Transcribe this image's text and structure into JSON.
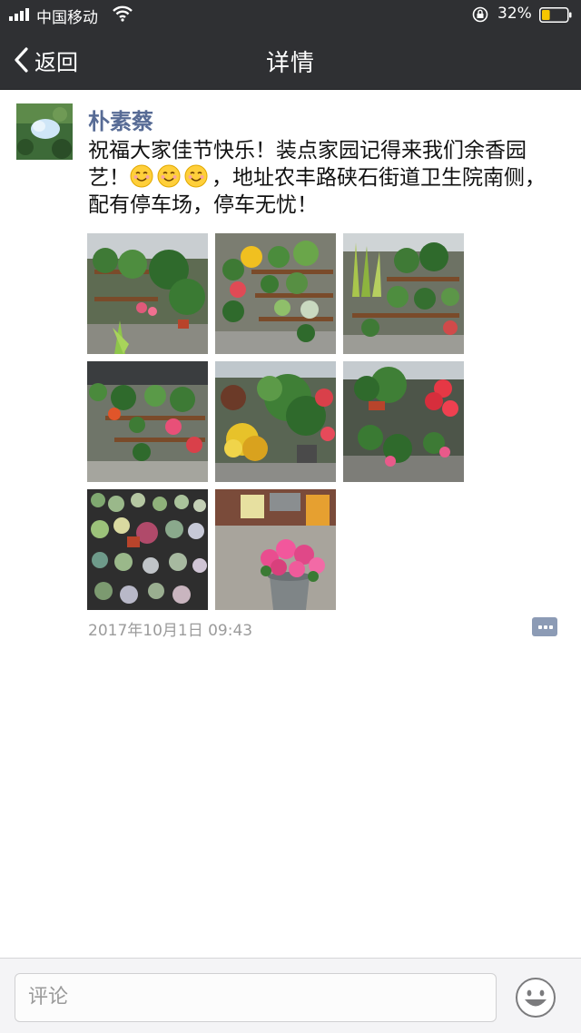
{
  "status_bar": {
    "carrier": "中国移动",
    "battery_percent": "32%",
    "battery_level": 0.32,
    "icons": [
      "signal-icon",
      "wifi-icon",
      "rotation-lock-icon",
      "battery-icon"
    ]
  },
  "nav": {
    "back_label": "返回",
    "title": "详情"
  },
  "post": {
    "author": "朴素蔡",
    "text_before_emoji": "祝福大家佳节快乐！装点家园记得来我们余香园艺！",
    "text_after_emoji": "，地址农丰路硖石街道卫生院南侧，配有停车场，停车无忧！",
    "emoji_count": 3,
    "photos": [
      {
        "name": "photo-plant-shelf-1"
      },
      {
        "name": "photo-plant-shelf-2"
      },
      {
        "name": "photo-plant-shelf-3"
      },
      {
        "name": "photo-greenhouse-racks"
      },
      {
        "name": "photo-coleus-plants"
      },
      {
        "name": "photo-red-flowers"
      },
      {
        "name": "photo-succulents"
      },
      {
        "name": "photo-pink-flower-pot"
      }
    ],
    "timestamp": "2017年10月1日 09:43"
  },
  "composer": {
    "placeholder": "评论"
  },
  "colors": {
    "bar_background": "#2f3033",
    "author_link": "#576b95",
    "battery_fill": "#f7c600",
    "comment_icon": "#8c9bb5"
  }
}
